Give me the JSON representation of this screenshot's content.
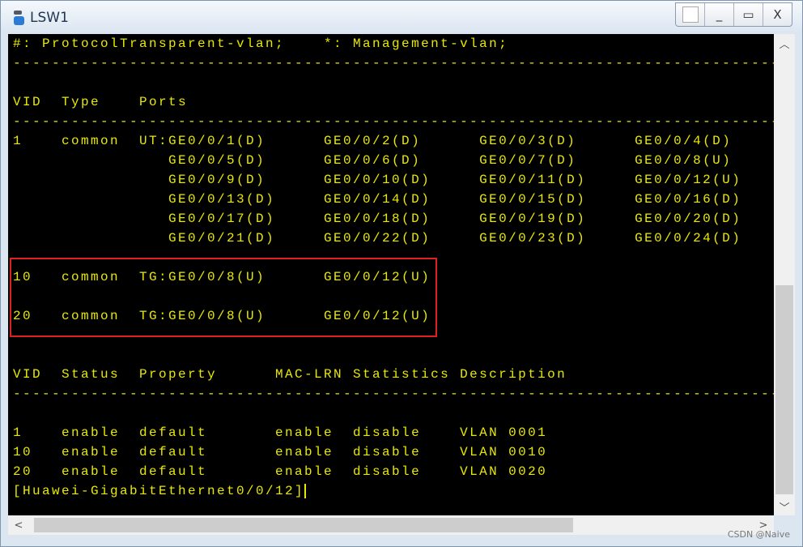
{
  "window": {
    "title": "LSW1",
    "controls": [
      "restore-box",
      "minimize",
      "maximize",
      "close"
    ],
    "close_label": "X",
    "min_label": "_",
    "max_label": "▭"
  },
  "terminal": {
    "text_color": "#e8e800",
    "lines": [
      "#: ProtocolTransparent-vlan;    *: Management-vlan;",
      "--------------------------------------------------------------------------------",
      "",
      "VID  Type    Ports",
      "--------------------------------------------------------------------------------",
      "1    common  UT:GE0/0/1(D)      GE0/0/2(D)      GE0/0/3(D)      GE0/0/4(D)",
      "                GE0/0/5(D)      GE0/0/6(D)      GE0/0/7(D)      GE0/0/8(U)",
      "                GE0/0/9(D)      GE0/0/10(D)     GE0/0/11(D)     GE0/0/12(U)",
      "                GE0/0/13(D)     GE0/0/14(D)     GE0/0/15(D)     GE0/0/16(D)",
      "                GE0/0/17(D)     GE0/0/18(D)     GE0/0/19(D)     GE0/0/20(D)",
      "                GE0/0/21(D)     GE0/0/22(D)     GE0/0/23(D)     GE0/0/24(D)",
      "",
      "10   common  TG:GE0/0/8(U)      GE0/0/12(U)",
      "",
      "20   common  TG:GE0/0/8(U)      GE0/0/12(U)",
      "",
      "",
      "VID  Status  Property      MAC-LRN Statistics Description",
      "--------------------------------------------------------------------------------",
      "",
      "1    enable  default       enable  disable    VLAN 0001",
      "10   enable  default       enable  disable    VLAN 0010",
      "20   enable  default       enable  disable    VLAN 0020"
    ],
    "prompt": "[Huawei-GigabitEthernet0/0/12]"
  },
  "watermark": "CSDN @Naive"
}
